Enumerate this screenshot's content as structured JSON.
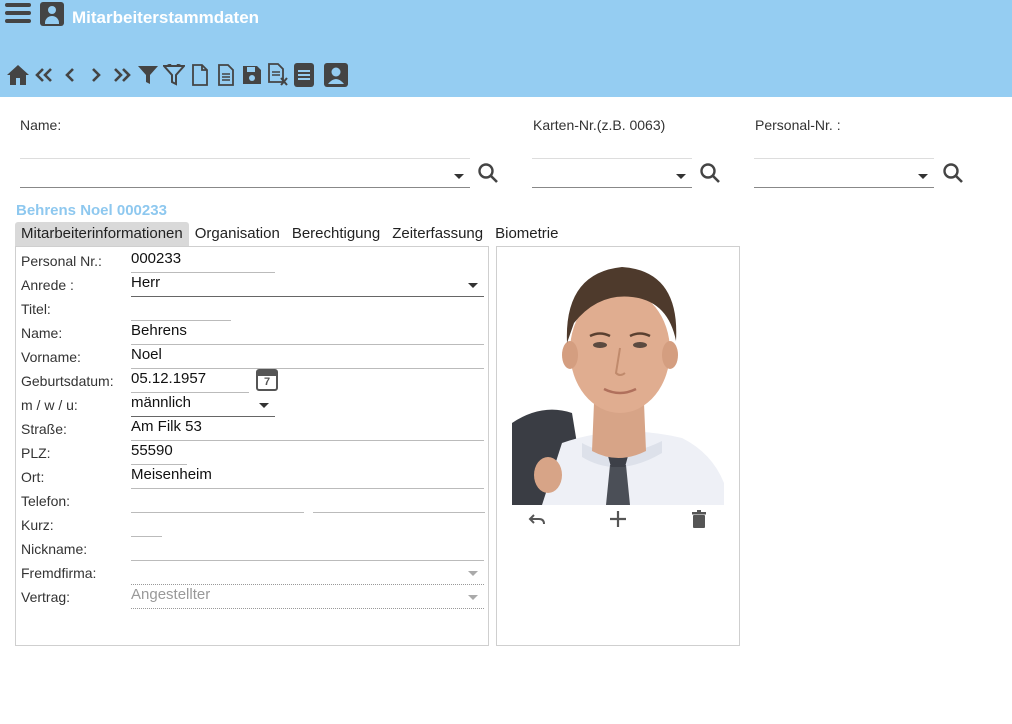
{
  "header": {
    "title": "Mitarbeiterstammdaten",
    "menu_icon": "menu-icon",
    "user_icon": "user-card-icon",
    "background": "#95cdf2"
  },
  "toolbar": [
    {
      "name": "home-icon"
    },
    {
      "name": "first-record-icon"
    },
    {
      "name": "previous-record-icon"
    },
    {
      "name": "next-record-icon"
    },
    {
      "name": "last-record-icon"
    },
    {
      "name": "filter-icon"
    },
    {
      "name": "filter-clear-icon"
    },
    {
      "name": "new-document-icon"
    },
    {
      "name": "document-text-icon"
    },
    {
      "name": "save-icon"
    },
    {
      "name": "document-delete-icon"
    },
    {
      "name": "report-icon"
    },
    {
      "name": "user-card-icon"
    }
  ],
  "search": {
    "name_label": "Name:",
    "card_label": "Karten-Nr.(z.B. 0063)",
    "personal_label": "Personal-Nr. :",
    "name_value": "",
    "card_value": "",
    "personal_value": ""
  },
  "employee": {
    "heading": "Behrens Noel 000233",
    "heading_color": "#8ec8ef"
  },
  "tabs": [
    {
      "label": "Mitarbeiterinformationen",
      "active": true
    },
    {
      "label": "Organisation",
      "active": false
    },
    {
      "label": "Berechtigung",
      "active": false
    },
    {
      "label": "Zeiterfassung",
      "active": false
    },
    {
      "label": "Biometrie",
      "active": false
    }
  ],
  "form": {
    "personal_nr": {
      "label": "Personal Nr.:",
      "value": "000233"
    },
    "anrede": {
      "label": "Anrede :",
      "value": "Herr"
    },
    "titel": {
      "label": "Titel:",
      "value": ""
    },
    "name": {
      "label": "Name:",
      "value": "Behrens"
    },
    "vorname": {
      "label": "Vorname:",
      "value": "Noel"
    },
    "geburtsdatum": {
      "label": "Geburtsdatum:",
      "value": "05.12.1957",
      "calendar_day": "7"
    },
    "geschlecht": {
      "label": "m / w / u:",
      "value": "männlich"
    },
    "strasse": {
      "label": "Straße:",
      "value": "Am Filk 53"
    },
    "plz": {
      "label": "PLZ:",
      "value": "55590"
    },
    "ort": {
      "label": "Ort:",
      "value": "Meisenheim"
    },
    "telefon": {
      "label": "Telefon:",
      "value": "",
      "value2": ""
    },
    "kurz": {
      "label": "Kurz:",
      "value": ""
    },
    "nickname": {
      "label": "Nickname:",
      "value": ""
    },
    "fremdfirma": {
      "label": "Fremdfirma:",
      "value": ""
    },
    "vertrag": {
      "label": "Vertrag:",
      "value": "Angestellter"
    }
  },
  "photo": {
    "actions": [
      "undo-icon",
      "add-icon",
      "trash-icon"
    ]
  }
}
